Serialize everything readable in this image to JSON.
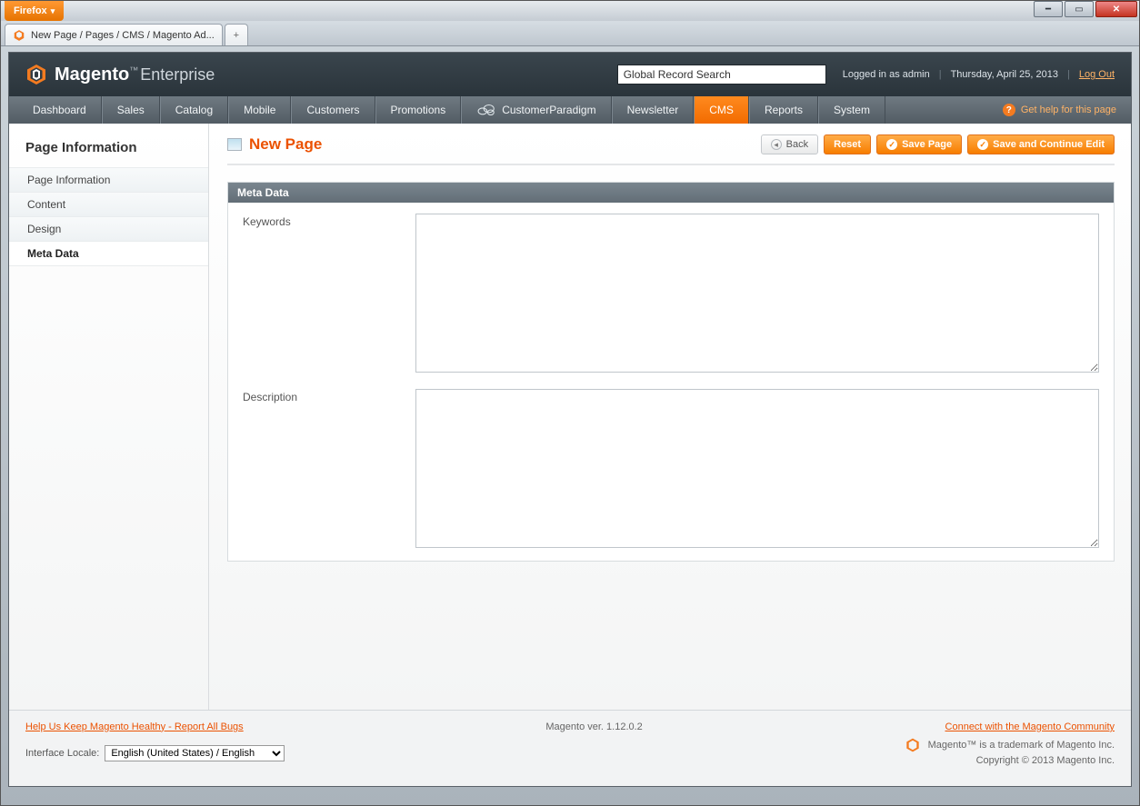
{
  "browser": {
    "name": "Firefox",
    "tab_title": "New Page / Pages / CMS / Magento Ad..."
  },
  "header": {
    "brand_bold": "Magento",
    "brand_light": "Enterprise",
    "search_placeholder": "Global Record Search",
    "logged_in": "Logged in as admin",
    "date": "Thursday, April 25, 2013",
    "logout": "Log Out"
  },
  "nav": {
    "items": [
      "Dashboard",
      "Sales",
      "Catalog",
      "Mobile",
      "Customers",
      "Promotions",
      "CustomerParadigm",
      "Newsletter",
      "CMS",
      "Reports",
      "System"
    ],
    "active_index": 8,
    "help": "Get help for this page"
  },
  "sidebar": {
    "title": "Page Information",
    "tabs": [
      "Page Information",
      "Content",
      "Design",
      "Meta Data"
    ],
    "active_index": 3
  },
  "page": {
    "title": "New Page",
    "buttons": {
      "back": "Back",
      "reset": "Reset",
      "save": "Save Page",
      "save_continue": "Save and Continue Edit"
    }
  },
  "fieldset": {
    "legend": "Meta Data",
    "fields": {
      "keywords_label": "Keywords",
      "keywords_value": "",
      "description_label": "Description",
      "description_value": ""
    }
  },
  "footer": {
    "bugs_link": "Help Us Keep Magento Healthy - Report All Bugs",
    "version": "Magento ver. 1.12.0.2",
    "community_link": "Connect with the Magento Community",
    "locale_label": "Interface Locale:",
    "locale_value": "English (United States) / English",
    "trademark": "Magento™ is a trademark of Magento Inc.",
    "copyright": "Copyright © 2013 Magento Inc."
  }
}
